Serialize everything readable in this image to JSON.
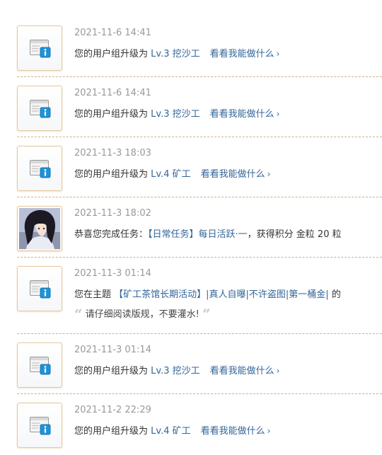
{
  "notifications": [
    {
      "type": "group",
      "time": "2021-11-6 14:41",
      "prefix": "您的用户组升级为",
      "level": "Lv.3 挖沙工",
      "action": "看看我能做什么"
    },
    {
      "type": "group",
      "time": "2021-11-6 14:41",
      "prefix": "您的用户组升级为",
      "level": "Lv.3 挖沙工",
      "action": "看看我能做什么"
    },
    {
      "type": "group",
      "time": "2021-11-3 18:03",
      "prefix": "您的用户组升级为",
      "level": "Lv.4 矿工",
      "action": "看看我能做什么"
    },
    {
      "type": "task",
      "time": "2021-11-3 18:02",
      "prefix": "恭喜您完成任务：",
      "task": "【日常任务】每日活跃·一",
      "suffix": "，获得积分 金粒 20 粒"
    },
    {
      "type": "topic",
      "time": "2021-11-3 01:14",
      "prefix": "您在主题",
      "topic": "【矿工茶馆长期活动】|真人自曝|不许盗图|第一桶金|",
      "suffix": "的",
      "quote": "请仔细阅读版规，不要灌水!"
    },
    {
      "type": "group",
      "time": "2021-11-3 01:14",
      "prefix": "您的用户组升级为",
      "level": "Lv.3 挖沙工",
      "action": "看看我能做什么"
    },
    {
      "type": "group",
      "time": "2021-11-2 22:29",
      "prefix": "您的用户组升级为",
      "level": "Lv.4 矿工",
      "action": "看看我能做什么"
    }
  ],
  "icons": {
    "system": "system-notice-icon",
    "chevron": "chevron-right-icon",
    "quote_open": "quote-open-icon",
    "quote_close": "quote-close-icon"
  },
  "colors": {
    "link": "#336699",
    "time": "#999999",
    "text": "#333333",
    "separator": "#c9b28f",
    "avatar_border": "#e3c89c",
    "icon_blue": "#1e93d6"
  }
}
